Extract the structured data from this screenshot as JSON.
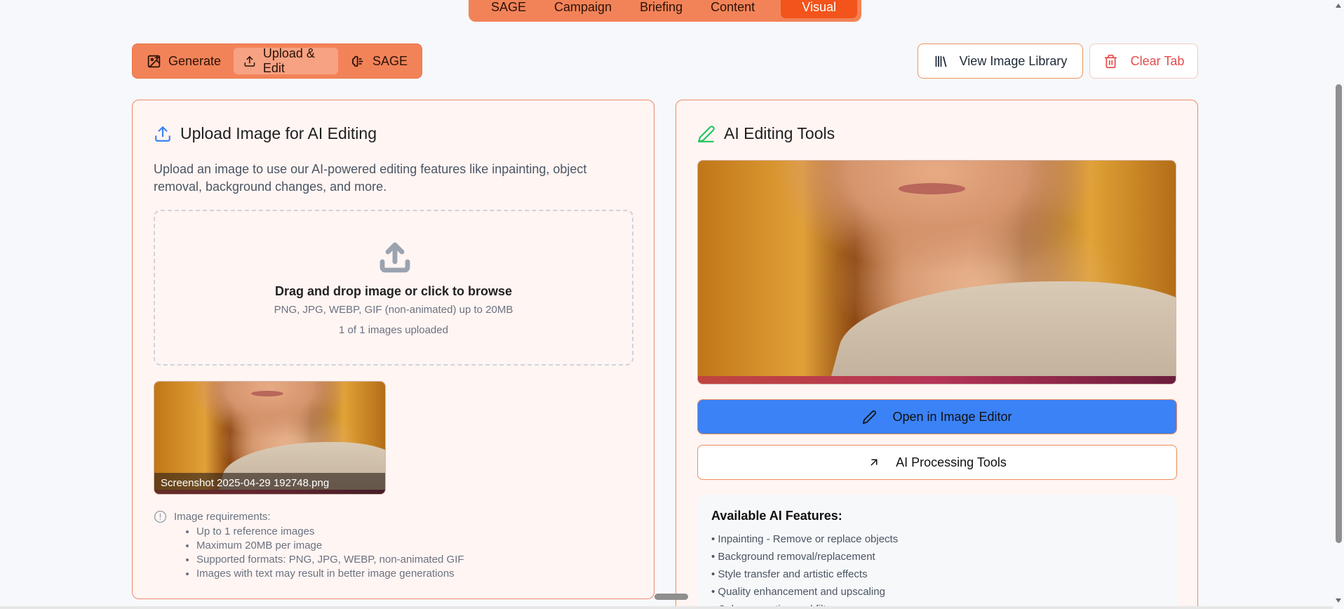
{
  "top_nav": {
    "tabs": [
      {
        "label": "SAGE"
      },
      {
        "label": "Campaign"
      },
      {
        "label": "Briefing"
      },
      {
        "label": "Content"
      },
      {
        "label": "Visual"
      }
    ]
  },
  "sub_tabs": [
    {
      "label": "Generate",
      "icon": "image-plus-icon"
    },
    {
      "label": "Upload & Edit",
      "icon": "upload-icon"
    },
    {
      "label": "SAGE",
      "icon": "brain-icon"
    }
  ],
  "actions": {
    "view_library": "View Image Library",
    "clear_tab": "Clear Tab"
  },
  "upload_panel": {
    "title": "Upload Image for AI Editing",
    "description": "Upload an image to use our AI-powered editing features like inpainting, object removal, background changes, and more.",
    "dropzone": {
      "title": "Drag and drop image or click to browse",
      "formats": "PNG, JPG, WEBP, GIF (non-animated) up to 20MB",
      "count": "1 of 1 images uploaded"
    },
    "thumbnail_name": "Screenshot 2025-04-29 192748.png",
    "requirements": {
      "heading": "Image requirements:",
      "items": [
        "Up to 1 reference images",
        "Maximum 20MB per image",
        "Supported formats: PNG, JPG, WEBP, non-animated GIF",
        "Images with text may result in better image generations"
      ]
    }
  },
  "tools_panel": {
    "title": "AI Editing Tools",
    "open_editor": "Open in Image Editor",
    "processing_tools": "AI Processing Tools",
    "features": {
      "heading": "Available AI Features:",
      "items": [
        "• Inpainting - Remove or replace objects",
        "• Background removal/replacement",
        "• Style transfer and artistic effects",
        "• Quality enhancement and upscaling",
        "• Color correction and filters"
      ]
    }
  },
  "colors": {
    "accent": "#f28359",
    "active_tab": "#f2541b",
    "primary_button": "#3b82f6",
    "danger": "#e34b4b"
  }
}
